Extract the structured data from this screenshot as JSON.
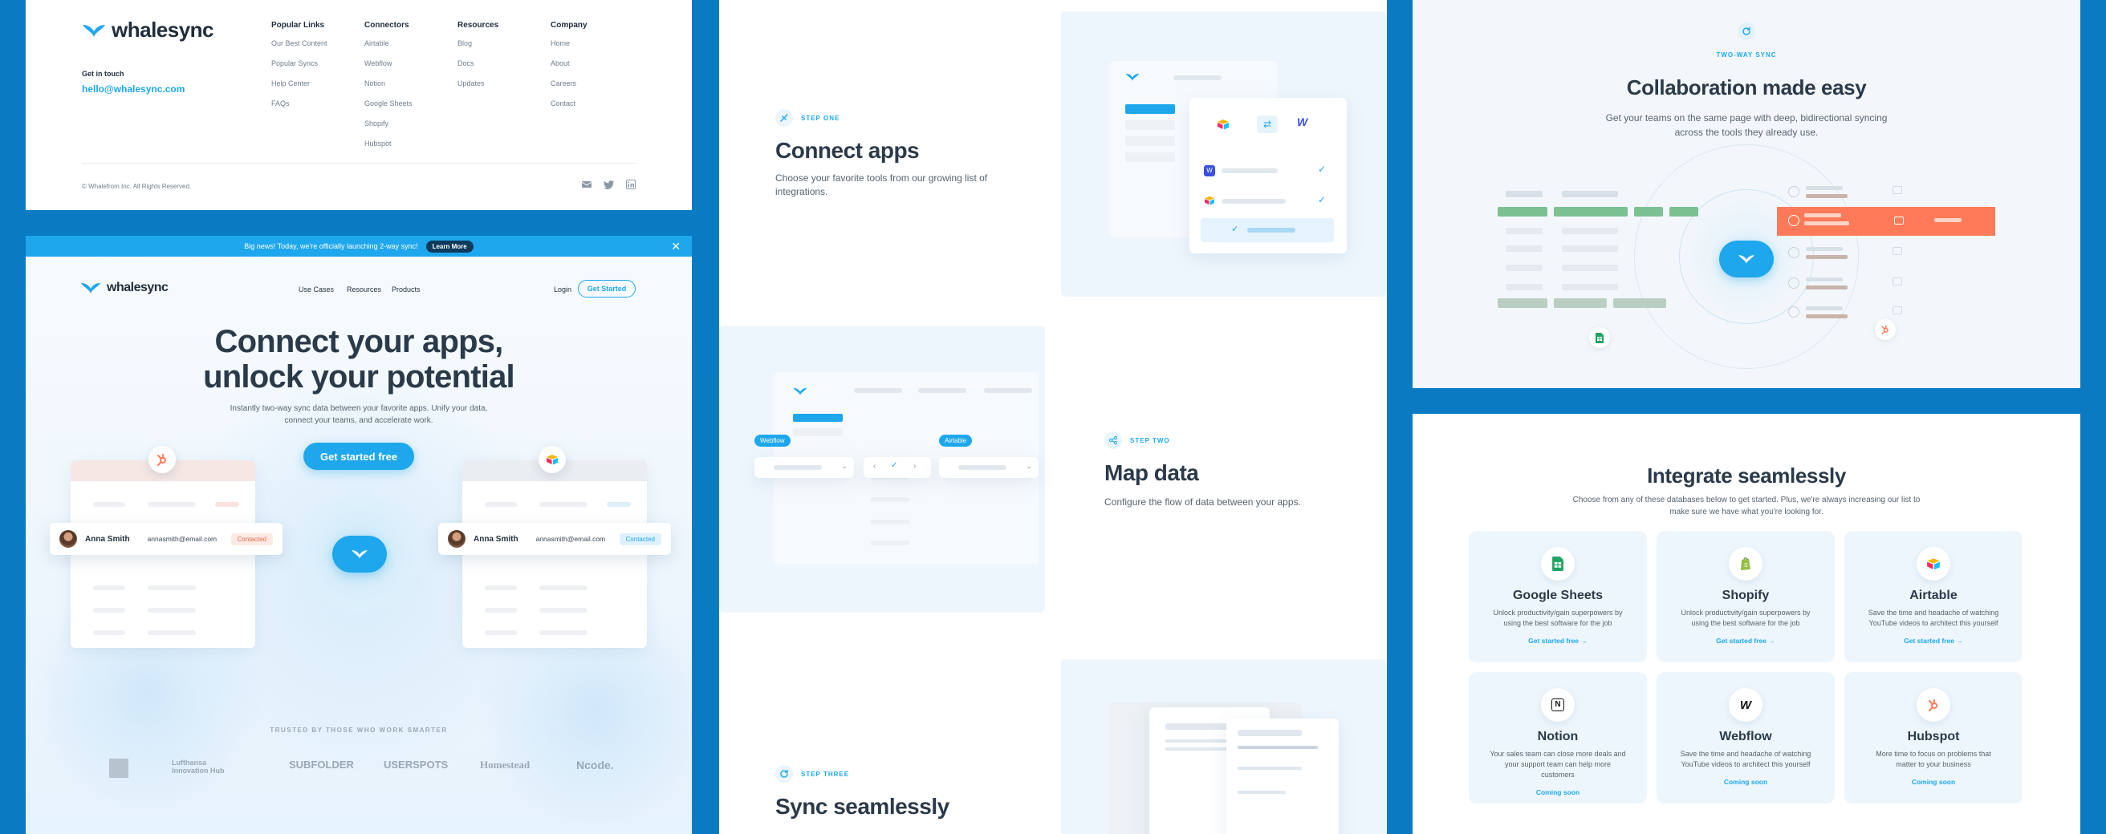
{
  "brand": {
    "name": "whalesync",
    "accent": "#1ea7ec",
    "dark": "#2b3a4a",
    "frame": "#0a7bc2"
  },
  "footer": {
    "get_in_touch": "Get in touch",
    "email": "hello@whalesync.com",
    "columns": [
      {
        "title": "Popular Links",
        "items": [
          "Our Best Content",
          "Popular Syncs",
          "Help Center",
          "FAQs"
        ]
      },
      {
        "title": "Connectors",
        "items": [
          "Airtable",
          "Webflow",
          "Notion",
          "Google Sheets",
          "Shopify",
          "Hubspot"
        ]
      },
      {
        "title": "Resources",
        "items": [
          "Blog",
          "Docs",
          "Updates"
        ]
      },
      {
        "title": "Company",
        "items": [
          "Home",
          "About",
          "Careers",
          "Contact"
        ]
      }
    ],
    "copyright": "© Whalefrom Inc. All Rights Reserved.",
    "social_icons": [
      "mail-icon",
      "twitter-icon",
      "linkedin-icon"
    ]
  },
  "hero": {
    "banner_text": "Big news! Today, we're officially launching 2-way sync!",
    "banner_button": "Learn More",
    "nav": [
      "Use Cases",
      "Resources",
      "Products"
    ],
    "login": "Login",
    "get_started": "Get Started",
    "title_line1": "Connect your apps,",
    "title_line2": "unlock your potential",
    "subtitle": "Instantly two-way sync data between your favorite apps. Unify your data, connect your teams, and accelerate work.",
    "cta": "Get started free",
    "left_row": {
      "name": "Anna Smith",
      "email": "annasmith@email.com",
      "status": "Contacted"
    },
    "right_row": {
      "name": "Anna Smith",
      "email": "annasmith@email.com",
      "status": "Contacted"
    },
    "trusted": "TRUSTED BY THOSE WHO WORK SMARTER",
    "logos": [
      "Lufthansa Innovation Hub",
      "SUBFOLDER",
      "USERSPOTS",
      "Homestead",
      "Ncode."
    ]
  },
  "steps": {
    "one": {
      "tag": "STEP ONE",
      "title": "Connect apps",
      "text": "Choose your favorite tools from our growing list of integrations."
    },
    "two": {
      "tag": "STEP TWO",
      "title": "Map data",
      "text": "Configure the flow of data between your apps.",
      "left_badge": "Webflow",
      "right_badge": "Airtable"
    },
    "three": {
      "tag": "STEP THREE",
      "title": "Sync seamlessly"
    }
  },
  "collab": {
    "tag": "TWO-WAY SYNC",
    "title": "Collaboration made easy",
    "subtitle_line1": "Get your teams on the same page with deep, bidirectional syncing",
    "subtitle_line2": "across the tools they already use."
  },
  "integrations": {
    "title": "Integrate seamlessly",
    "subtitle_line1": "Choose from any of these databases below to get started. Plus, we're always increasing our list to",
    "subtitle_line2": "make sure we have what you're looking for.",
    "cards": [
      {
        "name": "Google Sheets",
        "desc": "Unlock productivity/gain superpowers by using the best software for the job",
        "cta": "Get started free  →",
        "icon": "google-sheets-icon"
      },
      {
        "name": "Shopify",
        "desc": "Unlock productivity/gain superpowers by using the best software for the job",
        "cta": "Get started free  →",
        "icon": "shopify-icon"
      },
      {
        "name": "Airtable",
        "desc": "Save the time and headache of watching YouTube videos to architect this yourself",
        "cta": "Get started free  →",
        "icon": "airtable-icon"
      },
      {
        "name": "Notion",
        "desc": "Your sales team can close more deals and your support team can help more customers",
        "cta": "Coming soon",
        "icon": "notion-icon"
      },
      {
        "name": "Webflow",
        "desc": "Save the time and headache of watching YouTube videos to architect this yourself",
        "cta": "Coming soon",
        "icon": "webflow-icon"
      },
      {
        "name": "Hubspot",
        "desc": "More time to focus on problems that matter to your business",
        "cta": "Coming soon",
        "icon": "hubspot-icon"
      }
    ]
  }
}
